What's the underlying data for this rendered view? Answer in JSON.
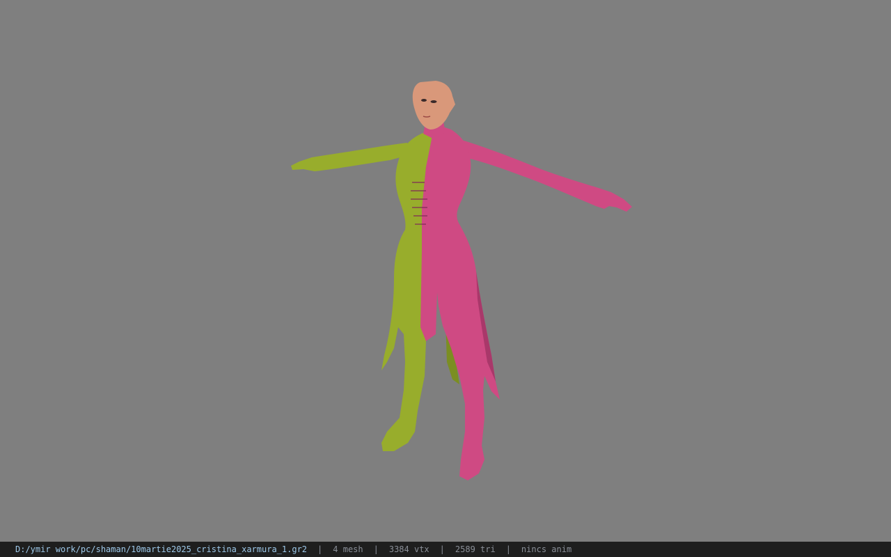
{
  "viewer": {
    "background_color": "#7f7f7f",
    "model": {
      "description": "character-model",
      "colors": {
        "skin": "#d9987a",
        "left_half": "#98ad2c",
        "right_half": "#cf4a83",
        "right_half_shadow": "#a9386a",
        "left_half_shadow": "#7b8e22"
      }
    }
  },
  "statusbar": {
    "file_path": "D:/ymir work/pc/shaman/10martie2025_cristina_xarmura_1.gr2",
    "separator": "|",
    "mesh_count": "4 mesh",
    "vertex_count": "3384 vtx",
    "triangle_count": "2589 tri",
    "animation": "nincs anim",
    "colors": {
      "background": "#1e1e1e",
      "path_text": "#9ec9ea",
      "stat_text": "#8a8f98"
    }
  }
}
